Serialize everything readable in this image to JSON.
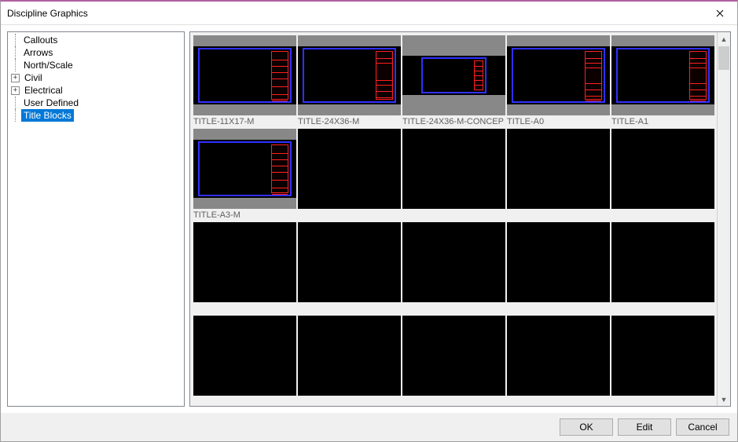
{
  "window": {
    "title": "Discipline Graphics"
  },
  "tree": {
    "items": [
      {
        "label": "Callouts",
        "has_children": false,
        "expanded": false,
        "selected": false
      },
      {
        "label": "Arrows",
        "has_children": false,
        "expanded": false,
        "selected": false
      },
      {
        "label": "North/Scale",
        "has_children": false,
        "expanded": false,
        "selected": false
      },
      {
        "label": "Civil",
        "has_children": true,
        "expanded": false,
        "selected": false
      },
      {
        "label": "Electrical",
        "has_children": true,
        "expanded": false,
        "selected": false
      },
      {
        "label": "User Defined",
        "has_children": false,
        "expanded": false,
        "selected": false
      },
      {
        "label": "Title Blocks",
        "has_children": false,
        "expanded": false,
        "selected": true
      }
    ]
  },
  "thumbnails": [
    {
      "label": "TITLE-11X17-M",
      "style": "titleblock_a"
    },
    {
      "label": "TITLE-24X36-M",
      "style": "titleblock_b"
    },
    {
      "label": "TITLE-24X36-M-CONCEP",
      "style": "titleblock_c"
    },
    {
      "label": "TITLE-A0",
      "style": "titleblock_d"
    },
    {
      "label": "TITLE-A1",
      "style": "titleblock_e"
    },
    {
      "label": "TITLE-A3-M",
      "style": "titleblock_f"
    },
    {
      "label": "",
      "style": "blank"
    },
    {
      "label": "",
      "style": "blank"
    },
    {
      "label": "",
      "style": "blank"
    },
    {
      "label": "",
      "style": "blank"
    },
    {
      "label": "",
      "style": "blank"
    },
    {
      "label": "",
      "style": "blank"
    },
    {
      "label": "",
      "style": "blank"
    },
    {
      "label": "",
      "style": "blank"
    },
    {
      "label": "",
      "style": "blank"
    },
    {
      "label": "",
      "style": "blank"
    },
    {
      "label": "",
      "style": "blank"
    },
    {
      "label": "",
      "style": "blank"
    },
    {
      "label": "",
      "style": "blank"
    },
    {
      "label": "",
      "style": "blank"
    }
  ],
  "buttons": {
    "ok": "OK",
    "edit": "Edit",
    "cancel": "Cancel"
  }
}
